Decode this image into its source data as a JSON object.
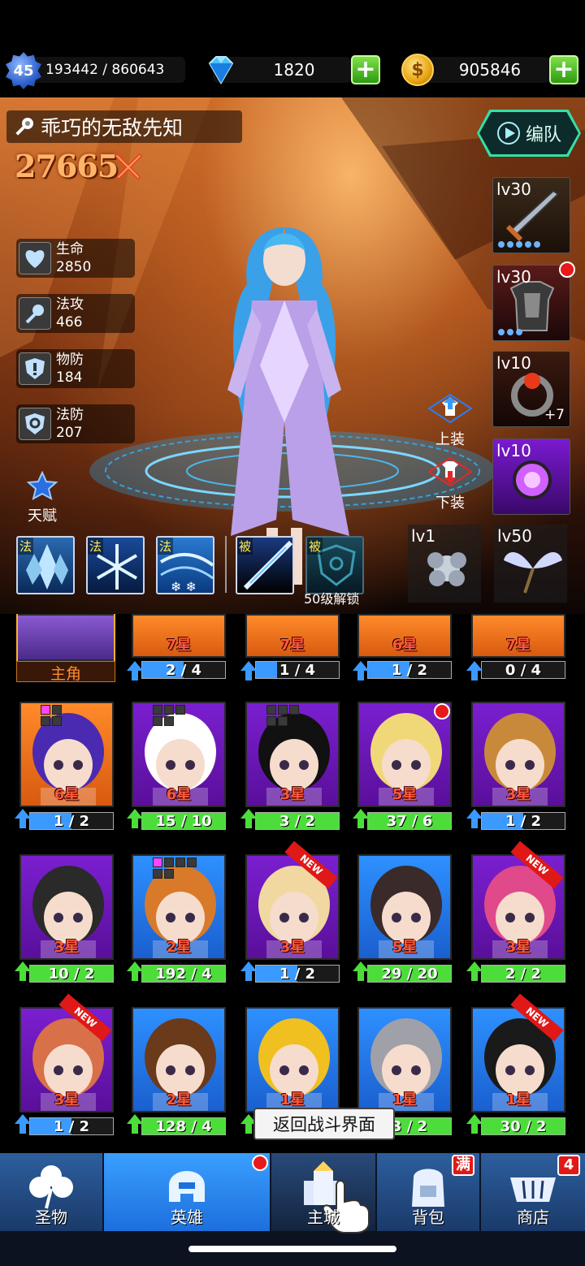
{
  "status": {
    "level": "45",
    "exp": "193442 / 860643",
    "gems": "1820",
    "gold": "905846",
    "coin_symbol": "$"
  },
  "hero": {
    "name": "乖巧的无敌先知",
    "power": "27665",
    "team_label": "编队",
    "stats": [
      {
        "label": "生命",
        "value": "2850",
        "icon": "heart-icon"
      },
      {
        "label": "法攻",
        "value": "466",
        "icon": "wand-icon"
      },
      {
        "label": "物防",
        "value": "184",
        "icon": "shield-icon"
      },
      {
        "label": "法防",
        "value": "207",
        "icon": "magic-shield-icon"
      }
    ],
    "talent_label": "天赋",
    "equip_label": "上装",
    "unequip_label": "下装"
  },
  "gear": [
    {
      "level": "lv30",
      "item": "sword"
    },
    {
      "level": "lv30",
      "item": "armor"
    },
    {
      "level": "lv10",
      "item": "ring",
      "bonus": "+7"
    },
    {
      "level": "lv10",
      "item": "amulet"
    },
    {
      "level": "lv1",
      "item": "flower"
    },
    {
      "level": "lv50",
      "item": "wings"
    }
  ],
  "skills": [
    {
      "tag": "法",
      "kind": "ice-crystal"
    },
    {
      "tag": "法",
      "kind": "frost-star"
    },
    {
      "tag": "法",
      "kind": "snow-storm"
    },
    {
      "tag": "被",
      "kind": "ice-blade"
    },
    {
      "tag": "被",
      "kind": "locked-shield"
    }
  ],
  "skill_lock_text": "50级解锁",
  "main_label": "主角",
  "heroes_row0": [
    {
      "stars": "",
      "progress": "",
      "fill": 0,
      "main": true
    },
    {
      "stars": "7星",
      "progress": "2 / 4",
      "fill": 0.5,
      "bg": "orange"
    },
    {
      "stars": "7星",
      "progress": "1 / 4",
      "fill": 0.25,
      "bg": "orange"
    },
    {
      "stars": "6星",
      "progress": "1 / 2",
      "fill": 0.5,
      "bg": "orange"
    },
    {
      "stars": "7星",
      "progress": "0 / 4",
      "fill": 0,
      "bg": "orange"
    }
  ],
  "heroes": [
    {
      "stars": "6星",
      "progress": "1 / 2",
      "fill": 0.5,
      "bg": "orange",
      "color": "#4a2ab0"
    },
    {
      "stars": "6星",
      "progress": "15 / 10",
      "fill": 1,
      "bg": "purple",
      "color": "#ffffff"
    },
    {
      "stars": "3星",
      "progress": "3 / 2",
      "fill": 1,
      "bg": "purple",
      "color": "#111111"
    },
    {
      "stars": "5星",
      "progress": "37 / 6",
      "fill": 1,
      "bg": "purple",
      "color": "#f0d878"
    },
    {
      "stars": "3星",
      "progress": "1 / 2",
      "fill": 0.5,
      "bg": "purple",
      "color": "#c88a3a"
    },
    {
      "stars": "3星",
      "progress": "10 / 2",
      "fill": 1,
      "bg": "purple",
      "color": "#2a2a2a"
    },
    {
      "stars": "2星",
      "progress": "192 / 4",
      "fill": 1,
      "bg": "blue",
      "color": "#d87a2a"
    },
    {
      "stars": "3星",
      "progress": "1 / 2",
      "fill": 0.5,
      "bg": "purple",
      "color": "#f0d8a0",
      "new": true
    },
    {
      "stars": "5星",
      "progress": "29 / 20",
      "fill": 1,
      "bg": "blue",
      "color": "#3a2a2a"
    },
    {
      "stars": "3星",
      "progress": "2 / 2",
      "fill": 1,
      "bg": "purple",
      "color": "#e04a8a",
      "new": true
    },
    {
      "stars": "3星",
      "progress": "1 / 2",
      "fill": 0.5,
      "bg": "purple",
      "color": "#d8704a",
      "new": true
    },
    {
      "stars": "2星",
      "progress": "128 / 4",
      "fill": 1,
      "bg": "blue",
      "color": "#6a3a1a"
    },
    {
      "stars": "1星",
      "progress": "",
      "fill": 1,
      "bg": "blue",
      "color": "#f0c020"
    },
    {
      "stars": "1星",
      "progress": "3 / 2",
      "fill": 1,
      "bg": "blue",
      "color": "#a0a0a8"
    },
    {
      "stars": "1星",
      "progress": "30 / 2",
      "fill": 1,
      "bg": "blue",
      "color": "#1a1a1a",
      "new": true
    }
  ],
  "new_tag": "NEW",
  "toast": "返回战斗界面",
  "nav": [
    {
      "label": "圣物",
      "icon": "clover-icon"
    },
    {
      "label": "英雄",
      "icon": "hero-helmet-icon",
      "active": true
    },
    {
      "label": "主城",
      "icon": "castle-icon"
    },
    {
      "label": "背包",
      "icon": "backpack-icon",
      "badge": "满"
    },
    {
      "label": "商店",
      "icon": "cart-icon",
      "badge": "4"
    }
  ],
  "colors": {
    "accent_green": "#33e0a8",
    "progress_green": "#4ddd3a",
    "progress_blue": "#3a9aff",
    "star_red": "#ff5a3a",
    "power_orange": "#ffb469"
  }
}
